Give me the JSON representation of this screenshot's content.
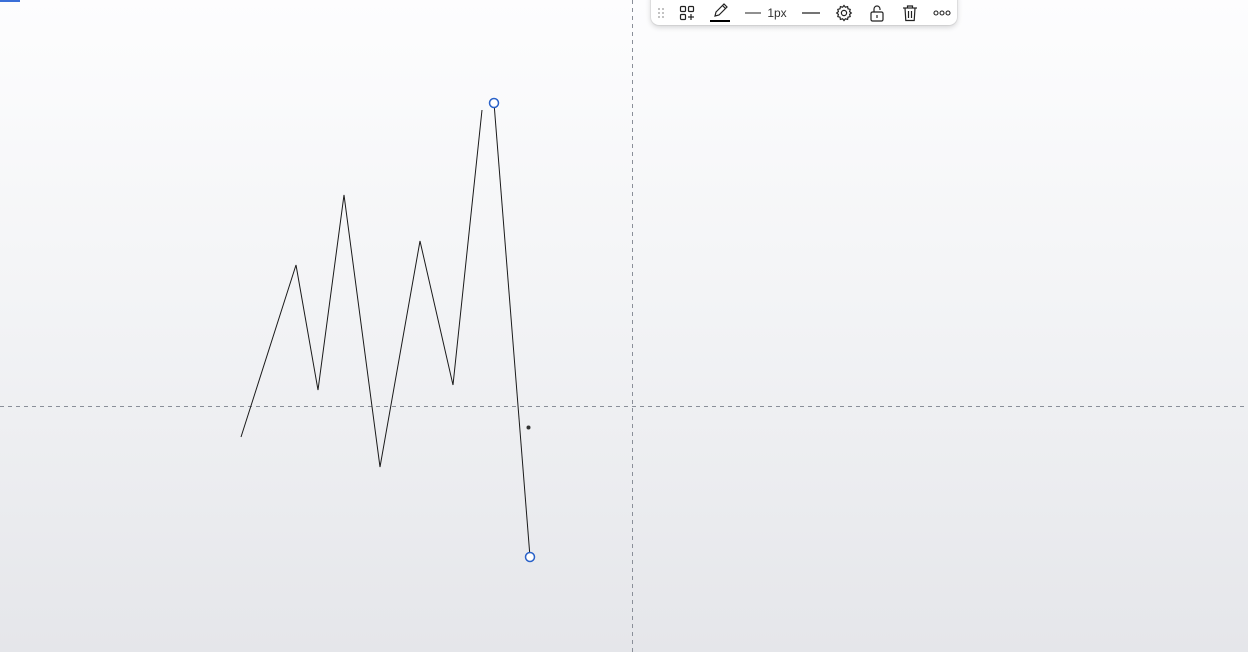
{
  "toolbar": {
    "drag_handle_icon": "drag-handle-icon",
    "templates_icon": "grid-plus-icon",
    "pencil_icon": "pencil-icon",
    "line_color": "#000000",
    "line_width_label": "1px",
    "line_style_icon": "line-style-icon",
    "settings_icon": "gear-icon",
    "lock_icon": "unlock-icon",
    "delete_icon": "trash-icon",
    "more_icon": "more-dots-icon"
  },
  "drawing": {
    "tool": "polyline",
    "stroke_color": "#1a1a1a",
    "handle_color": "#2a62c9",
    "crosshair_color": "#8a8f99"
  }
}
